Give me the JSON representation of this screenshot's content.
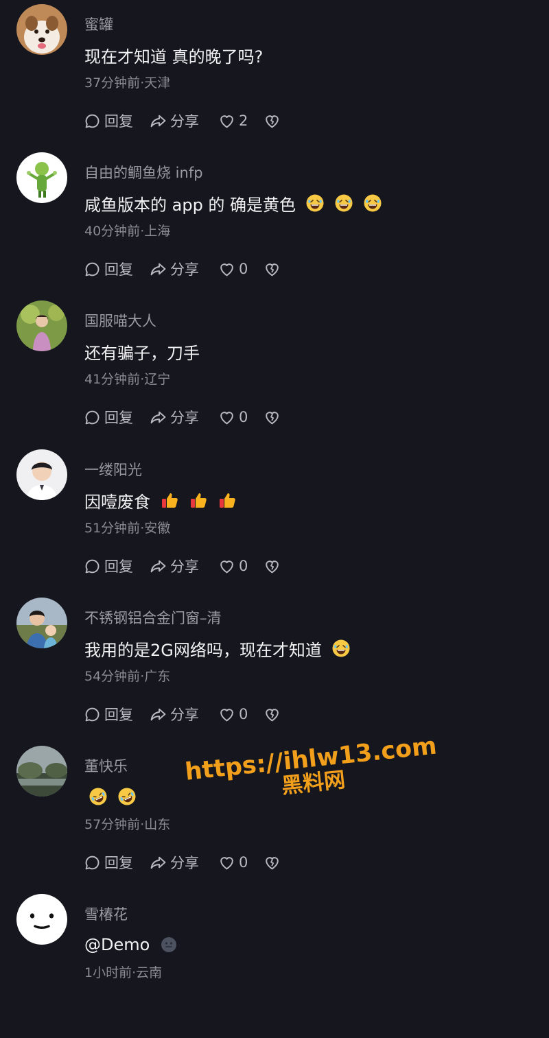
{
  "actions": {
    "reply_label": "回复",
    "share_label": "分享"
  },
  "comments": [
    {
      "username": "蜜罐",
      "text": "现在才知道 真的晚了吗?",
      "emojis": [],
      "time": "37分钟前",
      "location": "天津",
      "likes": "2"
    },
    {
      "username": "自由的鲷鱼烧 infp",
      "text": "咸鱼版本的 app 的 确是黄色",
      "emojis": [
        "grinning-sweat-emoji",
        "grinning-sweat-emoji",
        "grinning-sweat-emoji"
      ],
      "time": "40分钟前",
      "location": "上海",
      "likes": "0"
    },
    {
      "username": "国服喵大人",
      "text": "还有骗子，刀手",
      "emojis": [],
      "time": "41分钟前",
      "location": "辽宁",
      "likes": "0"
    },
    {
      "username": "一缕阳光",
      "text": "因噎废食",
      "emojis": [
        "thumbs-up-emoji",
        "thumbs-up-emoji",
        "thumbs-up-emoji"
      ],
      "time": "51分钟前",
      "location": "安徽",
      "likes": "0"
    },
    {
      "username": "不锈钢铝合金门窗–清",
      "text": "我用的是2G网络吗，现在才知道",
      "emojis": [
        "grinning-sweat-emoji"
      ],
      "time": "54分钟前",
      "location": "广东",
      "likes": "0"
    },
    {
      "username": "董快乐",
      "text": "",
      "emojis": [
        "rolling-laughing-emoji",
        "rolling-laughing-emoji"
      ],
      "time": "57分钟前",
      "location": "山东",
      "likes": "0"
    },
    {
      "username": "雪椿花",
      "text": "@Demo",
      "emojis": [
        "small-face-emoji"
      ],
      "time": "1小时前",
      "location": "云南",
      "likes": null
    }
  ],
  "watermark": {
    "url": "https://ihlw13.com",
    "name": "黑料网"
  },
  "colors": {
    "background": "#16161e",
    "watermark": "#f2a01c"
  }
}
